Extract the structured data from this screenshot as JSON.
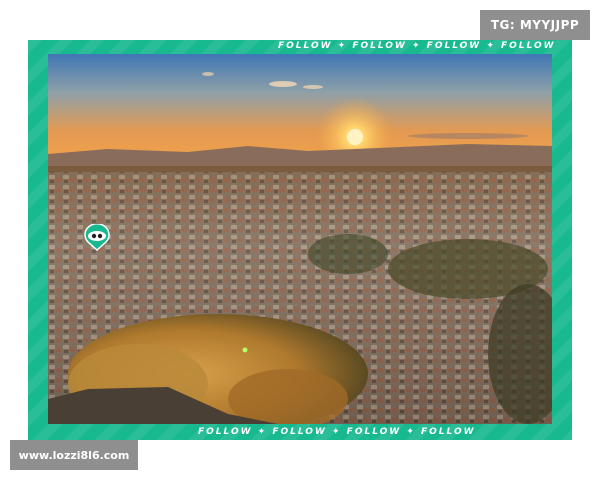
{
  "watermark_top": "TG: MYYJJPP",
  "watermark_bottom": "www.lozzi8l6.com",
  "frame": {
    "ticker_top": "FOLLOW  ✦  FOLLOW  ✦  FOLLOW  ✦  FOLLOW",
    "ticker_bottom": "FOLLOW  ✦  FOLLOW  ✦  FOLLOW  ✦  FOLLOW"
  },
  "photo": {
    "scene_icon": "sunset-cityscape-photo",
    "overlay_icon": "eye-badge-icon"
  },
  "colors": {
    "frame_green": "#19b98f",
    "badge_gray": "#8f8f8f",
    "sky_top": "#3f77b4",
    "sky_horizon": "#f2a24a",
    "sun": "#fff3c4"
  }
}
